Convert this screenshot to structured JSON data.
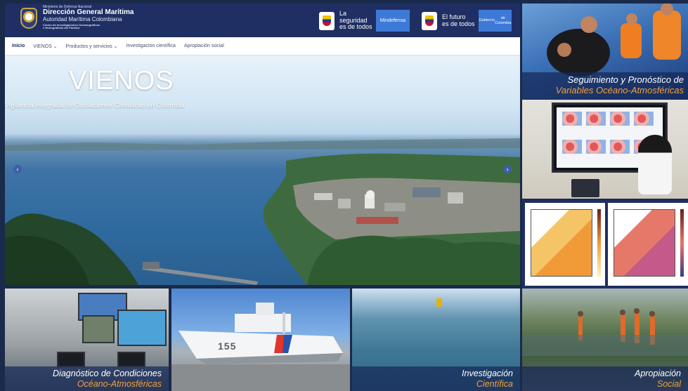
{
  "header": {
    "ministry": "Ministerio de Defensa Nacional",
    "agency_name": "Dirección General Marítima",
    "agency_sub": "Autoridad Marítima Colombiana",
    "center_line1": "Centro de Investigaciones Oceanográficas",
    "center_line2": "e Hidrográficas del Pacífico",
    "gov1_slogan_l1": "La seguridad",
    "gov1_slogan_l2": "es de todos",
    "gov1_pill": "Mindefensa",
    "gov2_slogan_l1": "El futuro",
    "gov2_slogan_l2": "es de todos",
    "gov2_pill_l1": "Gobierno",
    "gov2_pill_l2": "de Colombia"
  },
  "nav": {
    "items": [
      "Inicio",
      "VIENOS ⌄",
      "Productos y servicios ⌄",
      "Investigación científica",
      "Apropiación social"
    ]
  },
  "hero": {
    "title": "VIENOS",
    "subtitle": "Vigilancia Integrada de Oscilaciones Climáticas en Colombia",
    "prev_icon": "chevron-left-icon",
    "next_icon": "chevron-right-icon"
  },
  "cards": {
    "top_right": {
      "line1": "Seguimiento y Pronóstico de",
      "line2": "Variables Océano-Atmosféricas"
    },
    "bottom1": {
      "line1": "Diagnóstico de Condiciones",
      "line2": "Océano-Atmosféricas"
    },
    "bottom2": {
      "hull_number": "155"
    },
    "bottom3": {
      "line1": "Investigación",
      "line2": "Científica"
    },
    "bottom4": {
      "line1": "Apropiación",
      "line2": "Social"
    }
  },
  "colors": {
    "navy": "#1f2f63",
    "accent_orange": "#f3a13a",
    "pill_blue": "#3d79d6"
  }
}
